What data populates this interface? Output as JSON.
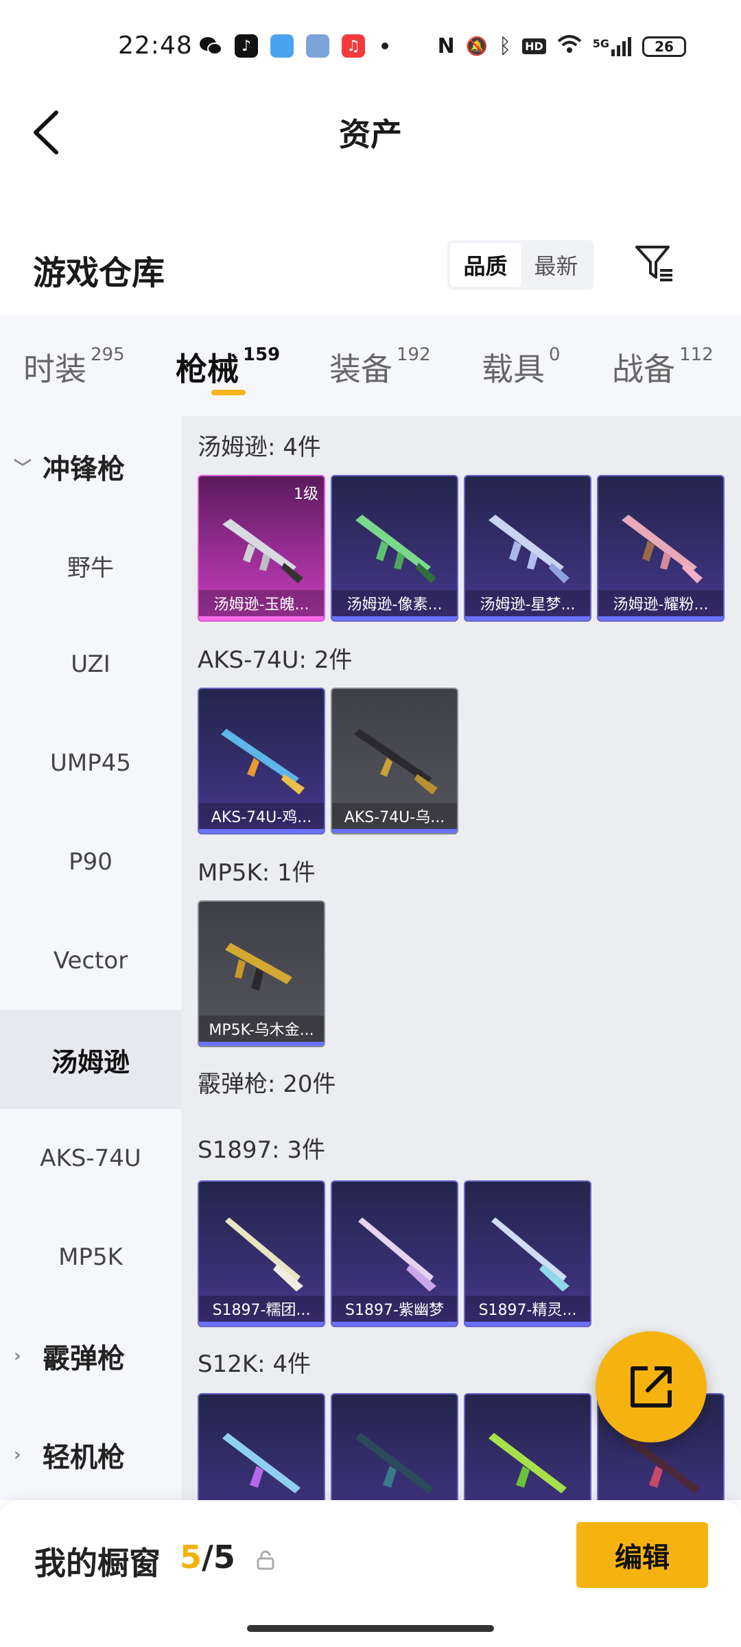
{
  "status_bar": {
    "time": "22:48",
    "network": "5G",
    "battery": "26",
    "hd_label": "HD"
  },
  "header": {
    "title": "资产"
  },
  "warehouse": {
    "title": "游戏仓库",
    "sort_options": [
      "品质",
      "最新"
    ],
    "sort_selected": "品质"
  },
  "tabs": [
    {
      "label": "时装",
      "count": "295"
    },
    {
      "label": "枪械",
      "count": "159"
    },
    {
      "label": "装备",
      "count": "192"
    },
    {
      "label": "载具",
      "count": "0"
    },
    {
      "label": "战备",
      "count": "112"
    }
  ],
  "sidebar": {
    "items": [
      {
        "label": "冲锋枪",
        "type": "category",
        "expanded": true
      },
      {
        "label": "野牛"
      },
      {
        "label": "UZI"
      },
      {
        "label": "UMP45"
      },
      {
        "label": "P90"
      },
      {
        "label": "Vector"
      },
      {
        "label": "汤姆逊",
        "selected": true
      },
      {
        "label": "AKS-74U"
      },
      {
        "label": "MP5K"
      },
      {
        "label": "霰弹枪",
        "type": "category"
      },
      {
        "label": "轻机枪",
        "type": "category"
      }
    ]
  },
  "groups": [
    {
      "title": "汤姆逊: 4件",
      "items": [
        {
          "name": "汤姆逊-玉魄...",
          "rarity": "pink",
          "level": "1级"
        },
        {
          "name": "汤姆逊-像素...",
          "rarity": "purple"
        },
        {
          "name": "汤姆逊-星梦...",
          "rarity": "purple"
        },
        {
          "name": "汤姆逊-耀粉...",
          "rarity": "purple"
        }
      ]
    },
    {
      "title": "AKS-74U: 2件",
      "items": [
        {
          "name": "AKS-74U-鸡...",
          "rarity": "purple"
        },
        {
          "name": "AKS-74U-乌...",
          "rarity": "grey"
        }
      ]
    },
    {
      "title": "MP5K: 1件",
      "items": [
        {
          "name": "MP5K-乌木金...",
          "rarity": "grey"
        }
      ]
    },
    {
      "title": "霰弹枪: 20件",
      "items": []
    },
    {
      "title": "S1897: 3件",
      "items": [
        {
          "name": "S1897-糯团...",
          "rarity": "purple"
        },
        {
          "name": "S1897-紫幽梦",
          "rarity": "purple"
        },
        {
          "name": "S1897-精灵...",
          "rarity": "purple"
        }
      ]
    },
    {
      "title": "S12K: 4件",
      "items": [
        {
          "name": "",
          "rarity": "purple"
        },
        {
          "name": "",
          "rarity": "purple"
        },
        {
          "name": "",
          "rarity": "purple"
        },
        {
          "name": "",
          "rarity": "purple"
        }
      ]
    }
  ],
  "bottom": {
    "title": "我的橱窗",
    "count_current": "5",
    "count_sep": "/",
    "count_total": "5",
    "edit_label": "编辑"
  },
  "colors": {
    "accent": "#f6b30f",
    "pink_rarity": "#c83fc0",
    "purple_rarity": "#3b3177",
    "grey_rarity": "#55565e"
  }
}
